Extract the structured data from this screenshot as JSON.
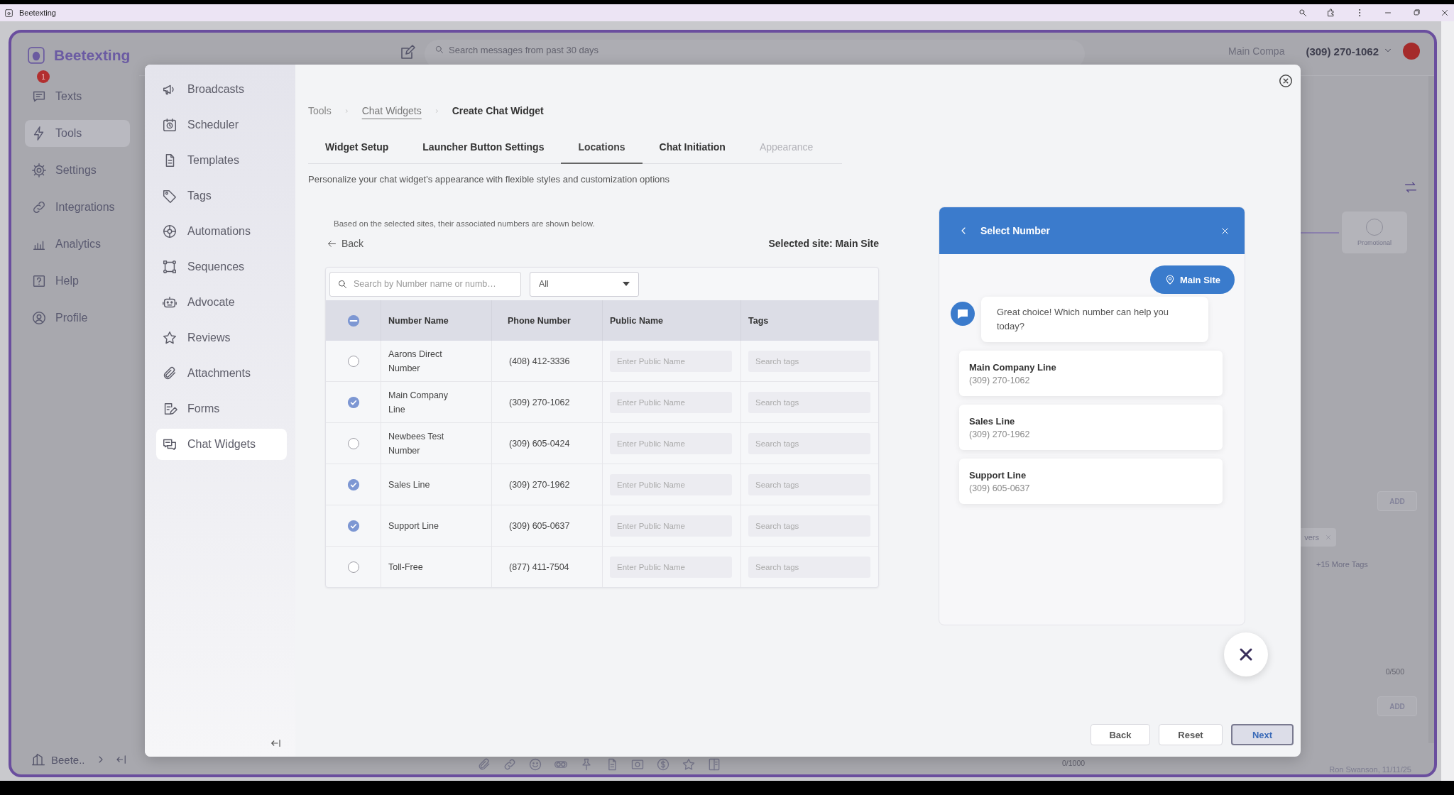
{
  "browser": {
    "title": "Beetexting"
  },
  "app": {
    "brand": "Beetexting",
    "nav": [
      {
        "label": "Texts",
        "badge": "1",
        "selected": false
      },
      {
        "label": "Tools",
        "selected": true
      },
      {
        "label": "Settings",
        "selected": false
      },
      {
        "label": "Integrations",
        "selected": false
      },
      {
        "label": "Analytics",
        "selected": false
      },
      {
        "label": "Help",
        "selected": false
      },
      {
        "label": "Profile",
        "selected": false
      }
    ],
    "workspace": "Beete..",
    "search": {
      "placeholder": "Search messages from past 30 days"
    },
    "account": {
      "company": "Main Compa",
      "phone": "(309) 270-1062"
    },
    "side_panel": {
      "card_label": "Promotional",
      "add_buttons": [
        "ADD",
        "ADD"
      ],
      "tag_chip": "vers",
      "more_tags": "+15 More Tags",
      "char_count": "0/500"
    },
    "composer": {
      "char_count": "0/1000",
      "signature": "Ron Swanson, 11/11/25"
    }
  },
  "modal": {
    "menu": [
      {
        "label": "Broadcasts",
        "selected": false
      },
      {
        "label": "Scheduler",
        "selected": false
      },
      {
        "label": "Templates",
        "selected": false
      },
      {
        "label": "Tags",
        "selected": false
      },
      {
        "label": "Automations",
        "selected": false
      },
      {
        "label": "Sequences",
        "selected": false
      },
      {
        "label": "Advocate",
        "selected": false
      },
      {
        "label": "Reviews",
        "selected": false
      },
      {
        "label": "Attachments",
        "selected": false
      },
      {
        "label": "Forms",
        "selected": false
      },
      {
        "label": "Chat Widgets",
        "selected": true
      }
    ],
    "breadcrumb": [
      "Tools",
      "Chat Widgets",
      "Create Chat Widget"
    ],
    "tabs": [
      {
        "label": "Widget Setup",
        "selected": false,
        "disabled": false
      },
      {
        "label": "Launcher Button Settings",
        "selected": false,
        "disabled": false
      },
      {
        "label": "Locations",
        "selected": true,
        "disabled": false
      },
      {
        "label": "Chat Initiation",
        "selected": false,
        "disabled": false
      },
      {
        "label": "Appearance",
        "selected": false,
        "disabled": true
      }
    ],
    "description": "Personalize your chat widget's appearance with flexible styles and customization options",
    "numbers": {
      "hint": "Based on the selected sites, their associated numbers are shown below.",
      "back": "Back",
      "selected_site": "Selected site: Main Site",
      "search": {
        "placeholder": "Search by Number name or numb…"
      },
      "filter": "All",
      "columns": [
        "Number Name",
        "Phone Number",
        "Public Name",
        "Tags"
      ],
      "header_all_selected": false,
      "header_some_selected": true,
      "rows": [
        {
          "name": "Aarons Direct Number",
          "phone": "(408) 412-3336",
          "public_name": {
            "placeholder": "Enter Public Name"
          },
          "tags": {
            "placeholder": "Search tags"
          },
          "selected": false
        },
        {
          "name": "Main Company Line",
          "phone": "(309) 270-1062",
          "public_name": {
            "placeholder": "Enter Public Name"
          },
          "tags": {
            "placeholder": "Search tags"
          },
          "selected": true
        },
        {
          "name": "Newbees Test Number",
          "phone": "(309) 605-0424",
          "public_name": {
            "placeholder": "Enter Public Name"
          },
          "tags": {
            "placeholder": "Search tags"
          },
          "selected": false
        },
        {
          "name": "Sales Line",
          "phone": "(309) 270-1962",
          "public_name": {
            "placeholder": "Enter Public Name"
          },
          "tags": {
            "placeholder": "Search tags"
          },
          "selected": true
        },
        {
          "name": "Support Line",
          "phone": "(309) 605-0637",
          "public_name": {
            "placeholder": "Enter Public Name"
          },
          "tags": {
            "placeholder": "Search tags"
          },
          "selected": true
        },
        {
          "name": "Toll-Free",
          "phone": "(877) 411-7504",
          "public_name": {
            "placeholder": "Enter Public Name"
          },
          "tags": {
            "placeholder": "Search tags"
          },
          "selected": false
        }
      ]
    },
    "preview": {
      "title": "Select Number",
      "site": "Main Site",
      "message": "Great choice! Which number can help you today?",
      "options": [
        {
          "name": "Main Company Line",
          "phone": "(309) 270-1062"
        },
        {
          "name": "Sales Line",
          "phone": "(309) 270-1962"
        },
        {
          "name": "Support Line",
          "phone": "(309) 605-0637"
        }
      ]
    },
    "buttons": [
      {
        "label": "Back",
        "primary": false
      },
      {
        "label": "Reset",
        "primary": false
      },
      {
        "label": "Next",
        "primary": true
      }
    ]
  }
}
